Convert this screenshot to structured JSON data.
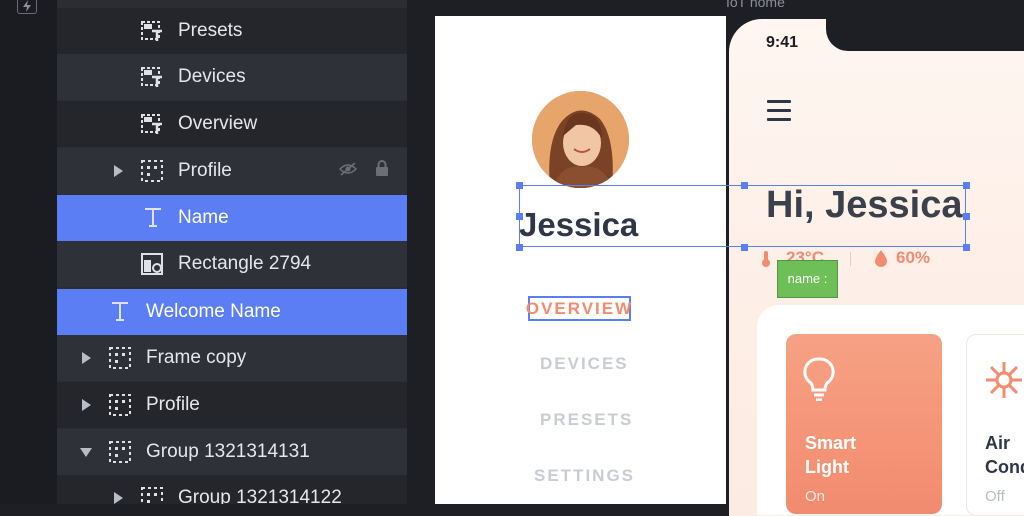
{
  "layers": {
    "rows": [
      {
        "label": "Presets",
        "icon": "text-frame-icon"
      },
      {
        "label": "Devices",
        "icon": "text-frame-icon"
      },
      {
        "label": "Overview",
        "icon": "text-frame-icon"
      },
      {
        "label": "Profile",
        "icon": "group-icon"
      },
      {
        "label": "Name",
        "icon": "text-icon"
      },
      {
        "label": "Rectangle 2794",
        "icon": "image-shape-icon"
      },
      {
        "label": "Welcome Name",
        "icon": "text-icon"
      },
      {
        "label": "Frame copy",
        "icon": "group-icon"
      },
      {
        "label": "Profile",
        "icon": "group-icon"
      },
      {
        "label": "Group 1321314131",
        "icon": "group-icon"
      },
      {
        "label": "Group 1321314122",
        "icon": "group-icon"
      }
    ]
  },
  "canvas": {
    "frame_label": "IoT home",
    "drawer": {
      "user_name": "Jessica",
      "nav": [
        "OVERVIEW",
        "DEVICES",
        "PRESETS",
        "SETTINGS"
      ]
    },
    "phone": {
      "time": "9:41",
      "greeting": "Hi, Jessica",
      "temperature": "23°C",
      "humidity": "60%",
      "cards": [
        {
          "title_line1": "Smart",
          "title_line2": "Light",
          "status": "On"
        },
        {
          "title_line1": "Air",
          "title_line2": "Cond",
          "status": "Off"
        }
      ]
    },
    "name_tag": "name :"
  },
  "colors": {
    "selection": "#5b7ef5",
    "accent": "#f28b6f",
    "tag_green": "#6fbf58"
  }
}
